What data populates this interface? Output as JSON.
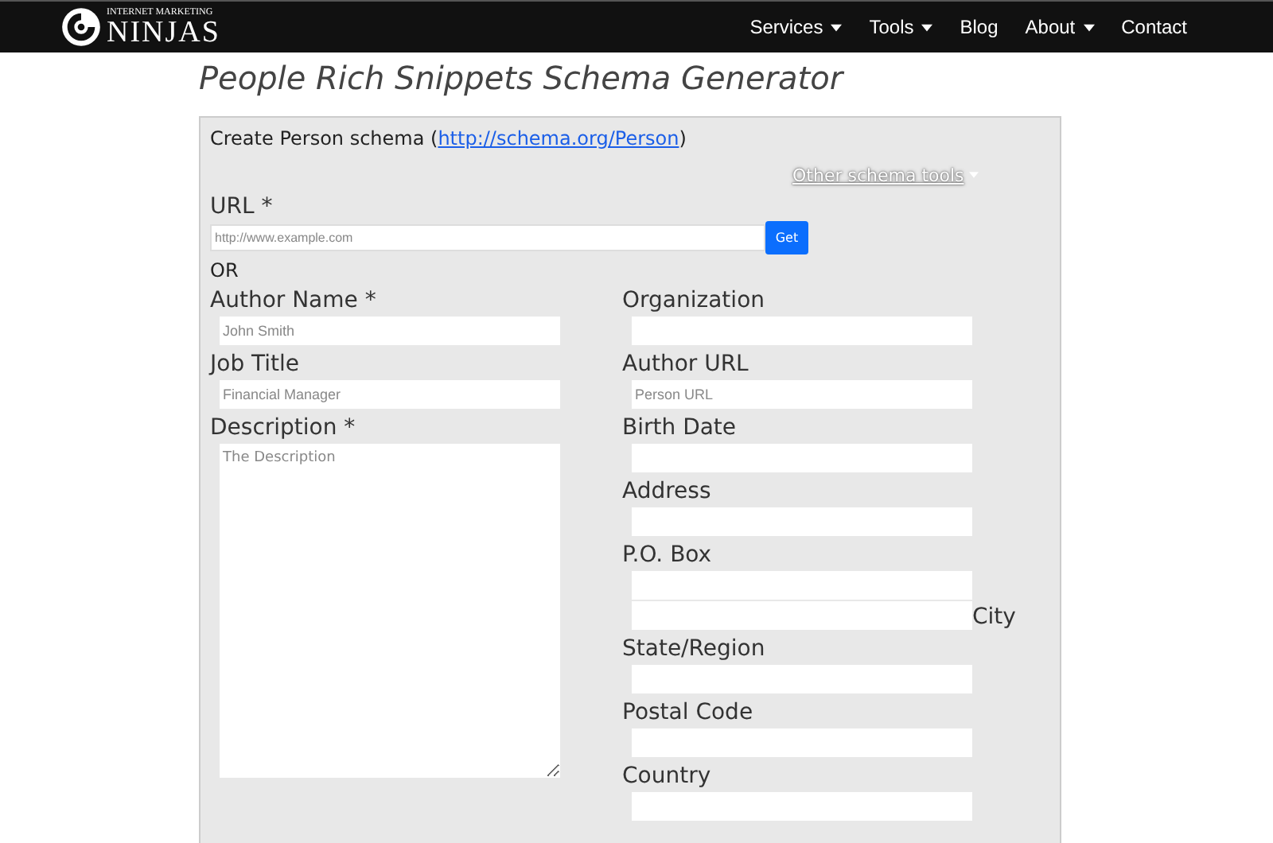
{
  "header": {
    "logo": {
      "small": "INTERNET MARKETING",
      "big": "NINJAS"
    },
    "nav": [
      {
        "label": "Services",
        "dropdown": true
      },
      {
        "label": "Tools",
        "dropdown": true
      },
      {
        "label": "Blog",
        "dropdown": false
      },
      {
        "label": "About",
        "dropdown": true
      },
      {
        "label": "Contact",
        "dropdown": false
      }
    ]
  },
  "title": "People Rich Snippets Schema Generator",
  "panel": {
    "intro": "Create Person schema (",
    "intro_link": "http://schema.org/Person",
    "intro_end": ")",
    "other_tools": "Other schema tools",
    "url_label": "URL *",
    "url_placeholder": "http://www.example.com",
    "get_button": "Get",
    "or": "OR",
    "left": [
      {
        "kind": "input",
        "label": "Author Name *",
        "placeholder": "John Smith"
      },
      {
        "kind": "input",
        "label": "Job Title",
        "placeholder": "Financial Manager"
      },
      {
        "kind": "textarea",
        "label": "Description *",
        "placeholder": "The Description"
      }
    ],
    "right": [
      {
        "kind": "above",
        "label": "Organization"
      },
      {
        "kind": "above",
        "label": "Author URL",
        "placeholder": "Person URL"
      },
      {
        "kind": "above",
        "label": "Birth Date"
      },
      {
        "kind": "above",
        "label": "Address"
      },
      {
        "kind": "above",
        "label": "P.O. Box"
      },
      {
        "kind": "after",
        "label": "City"
      },
      {
        "kind": "above",
        "label": "State/Region"
      },
      {
        "kind": "above",
        "label": "Postal Code"
      },
      {
        "kind": "above",
        "label": "Country"
      }
    ]
  }
}
